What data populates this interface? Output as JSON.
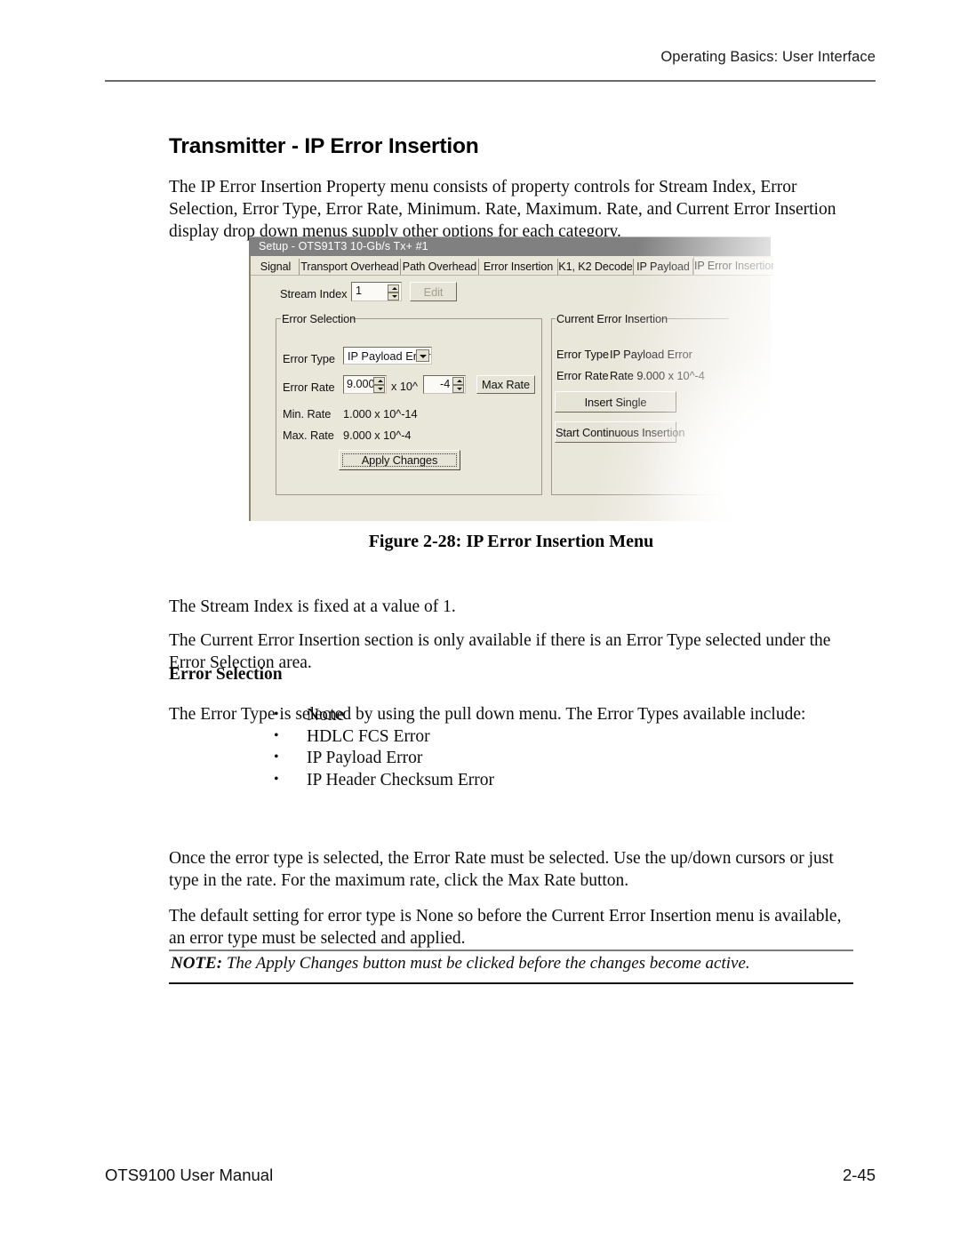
{
  "header": {
    "running_head": "Operating Basics: User Interface"
  },
  "title": "Transmitter - IP Error Insertion",
  "paragraphs": {
    "intro": "The IP Error Insertion Property menu consists of property controls for Stream Index, Error Selection, Error Type, Error Rate, Minimum. Rate, Maximum. Rate, and Current Error Insertion display drop down menus supply other options for each category.",
    "stream_index": "The Stream Index is fixed at a value of 1.",
    "current_error": "The Current Error Insertion section is only available if there is an Error Type selected under the Error Selection area.",
    "error_type_intro": "The Error Type is selected by using the pull down menu.  The Error Types available include:",
    "once": "Once the error type is selected, the Error Rate must be selected.  Use the up/down cursors or just type in the rate.  For the maximum rate, click the Max Rate button.",
    "default": "The default setting for error type is None so before the Current Error Insertion menu is available, an error type must be selected and applied."
  },
  "headings": {
    "error_selection": "Error Selection"
  },
  "bullets": [
    "None",
    "HDLC FCS Error",
    "IP Payload Error",
    "IP Header Checksum Error"
  ],
  "note": {
    "label": "NOTE:",
    "text": " The Apply Changes button must be clicked before the changes become active."
  },
  "figure": {
    "caption": "Figure 2-28: IP Error Insertion Menu"
  },
  "footer": {
    "left": "OTS9100 User Manual",
    "right": "2-45"
  },
  "dialog": {
    "titlebar": "Setup - OTS91T3 10-Gb/s Tx+ #1",
    "tabs": [
      {
        "label": "Signal",
        "active": false
      },
      {
        "label": "Transport Overhead",
        "active": false
      },
      {
        "label": "Path Overhead",
        "active": false
      },
      {
        "label": "Error Insertion",
        "active": false
      },
      {
        "label": "K1, K2 Decode",
        "active": false
      },
      {
        "label": "IP Payload",
        "active": false
      },
      {
        "label": "IP Error Insertion",
        "active": true
      }
    ],
    "stream_index": {
      "label": "Stream Index",
      "value": "1",
      "edit_button": "Edit"
    },
    "error_selection": {
      "group_title": "Error Selection",
      "error_type_label": "Error Type",
      "error_type_value": "IP Payload Error",
      "error_rate_label": "Error Rate",
      "mantissa": "9.000",
      "times_label": "x 10^",
      "exponent": "-4",
      "max_rate_button": "Max Rate",
      "min_rate_label": "Min. Rate",
      "min_rate_value": "1.000 x 10^-14",
      "max_rate_label": "Max. Rate",
      "max_rate_value": "9.000 x 10^-4",
      "apply_button": "Apply Changes"
    },
    "current_error_insertion": {
      "group_title": "Current Error Insertion",
      "error_type_label": "Error Type",
      "error_type_value": "IP Payload Error",
      "error_rate_label": "Error Rate",
      "error_rate_value": "Rate 9.000 x 10^-4",
      "insert_single_button": "Insert Single",
      "start_continuous_button": "Start Continuous Insertion"
    }
  },
  "colors": {
    "titlebar": "#808080",
    "dialog_bg": "#e9e6da",
    "rule": "#6b6b6b"
  }
}
